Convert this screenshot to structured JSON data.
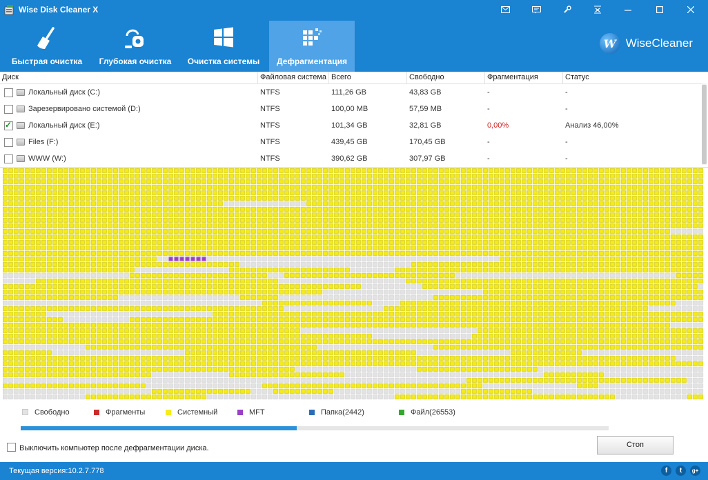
{
  "app": {
    "title": "Wise Disk Cleaner X",
    "brand": "WiseCleaner",
    "brand_letter": "W"
  },
  "title_buttons": [
    "mail-icon",
    "feedback-icon",
    "settings-icon",
    "skin-icon",
    "minimize-icon",
    "maximize-icon",
    "close-icon"
  ],
  "tabs": [
    {
      "label": "Быстрая очистка",
      "icon": "broom-icon",
      "active": false
    },
    {
      "label": "Глубокая очистка",
      "icon": "vacuum-icon",
      "active": false
    },
    {
      "label": "Очистка системы",
      "icon": "windows-icon",
      "active": false
    },
    {
      "label": "Дефрагментация",
      "icon": "defrag-icon",
      "active": true
    }
  ],
  "table": {
    "headers": [
      "Диск",
      "Файловая система",
      "Всего",
      "Свободно",
      "Фрагментация",
      "Статус"
    ],
    "rows": [
      {
        "checked": false,
        "disk": "Локальный диск (C:)",
        "fs": "NTFS",
        "total": "111,26 GB",
        "free": "43,83 GB",
        "frag": "-",
        "status": "-"
      },
      {
        "checked": false,
        "disk": "Зарезервировано системой (D:)",
        "fs": "NTFS",
        "total": "100,00 MB",
        "free": "57,59 MB",
        "frag": "-",
        "status": "-"
      },
      {
        "checked": true,
        "disk": "Локальный диск (E:)",
        "fs": "NTFS",
        "total": "101,34 GB",
        "free": "32,81 GB",
        "frag": "0,00%",
        "status": "Анализ 46,00%"
      },
      {
        "checked": false,
        "disk": "Files (F:)",
        "fs": "NTFS",
        "total": "439,45 GB",
        "free": "170,45 GB",
        "frag": "-",
        "status": "-"
      },
      {
        "checked": false,
        "disk": "WWW (W:)",
        "fs": "NTFS",
        "total": "390,62 GB",
        "free": "307,97 GB",
        "frag": "-",
        "status": "-"
      }
    ]
  },
  "legend": [
    {
      "label": "Свободно",
      "color": "#e3e3e3"
    },
    {
      "label": "Фрагменты",
      "color": "#cc2b2b"
    },
    {
      "label": "Системный",
      "color": "#f5ec1d"
    },
    {
      "label": "MFT",
      "color": "#9b3fc7"
    },
    {
      "label": "Папка(2442)",
      "color": "#2a6db5"
    },
    {
      "label": "Файл(26553)",
      "color": "#34a82e"
    }
  ],
  "progress": 0.47,
  "shutdown_label": "Выключить компьютер после дефрагментации диска.",
  "stop_label": "Стоп",
  "version_text": "Текущая версия:10.2.7.778",
  "social": [
    "facebook-icon",
    "twitter-icon",
    "google-plus-icon"
  ],
  "colors": {
    "accent": "#1a83d2",
    "active_tab": "#4fa3e6",
    "system": "#f5ec1d",
    "free": "#e3e3e3",
    "mft": "#9b3fc7",
    "frag_value": "#cc2222"
  }
}
